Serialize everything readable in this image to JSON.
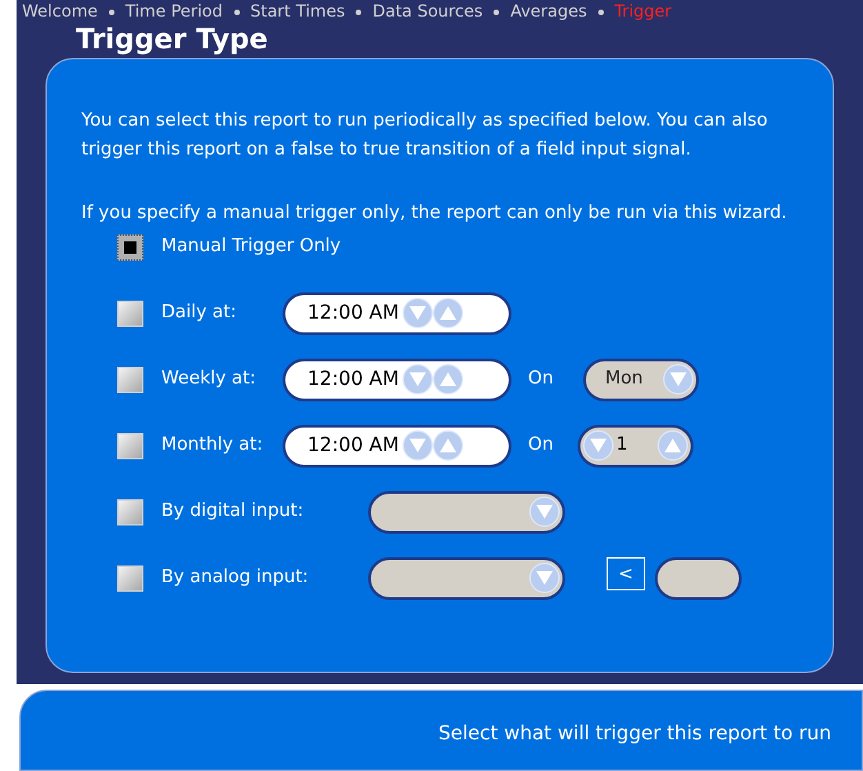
{
  "breadcrumb": [
    {
      "label": "Welcome",
      "selected": false
    },
    {
      "label": "Time Period",
      "selected": false
    },
    {
      "label": "Start Times",
      "selected": false
    },
    {
      "label": "Data Sources",
      "selected": false
    },
    {
      "label": "Averages",
      "selected": false
    },
    {
      "label": "Trigger",
      "selected": true
    }
  ],
  "title": "Trigger Type",
  "paragraphs": [
    "You can select this report to run periodically as specified below. You can also trigger this report on a false to true transition of a field input signal.",
    "If you specify a manual trigger only, the report can only be run via this wizard."
  ],
  "options": [
    {
      "kind": "plain",
      "label": "Manual Trigger Only",
      "checked": true
    },
    {
      "kind": "time",
      "label": "Daily at:",
      "checked": false,
      "time": "12:00 AM"
    },
    {
      "kind": "time_day",
      "label": "Weekly at:",
      "checked": false,
      "time": "12:00 AM",
      "on_label": "On",
      "day": "Mon"
    },
    {
      "kind": "time_number",
      "label": "Monthly at:",
      "checked": false,
      "time": "12:00 AM",
      "on_label": "On",
      "number": "1"
    },
    {
      "kind": "select",
      "label": "By digital input:",
      "checked": false
    },
    {
      "kind": "select_threshold",
      "label": "By analog input:",
      "checked": false,
      "operator": "<"
    }
  ],
  "footer": "Select what will trigger this report to run"
}
